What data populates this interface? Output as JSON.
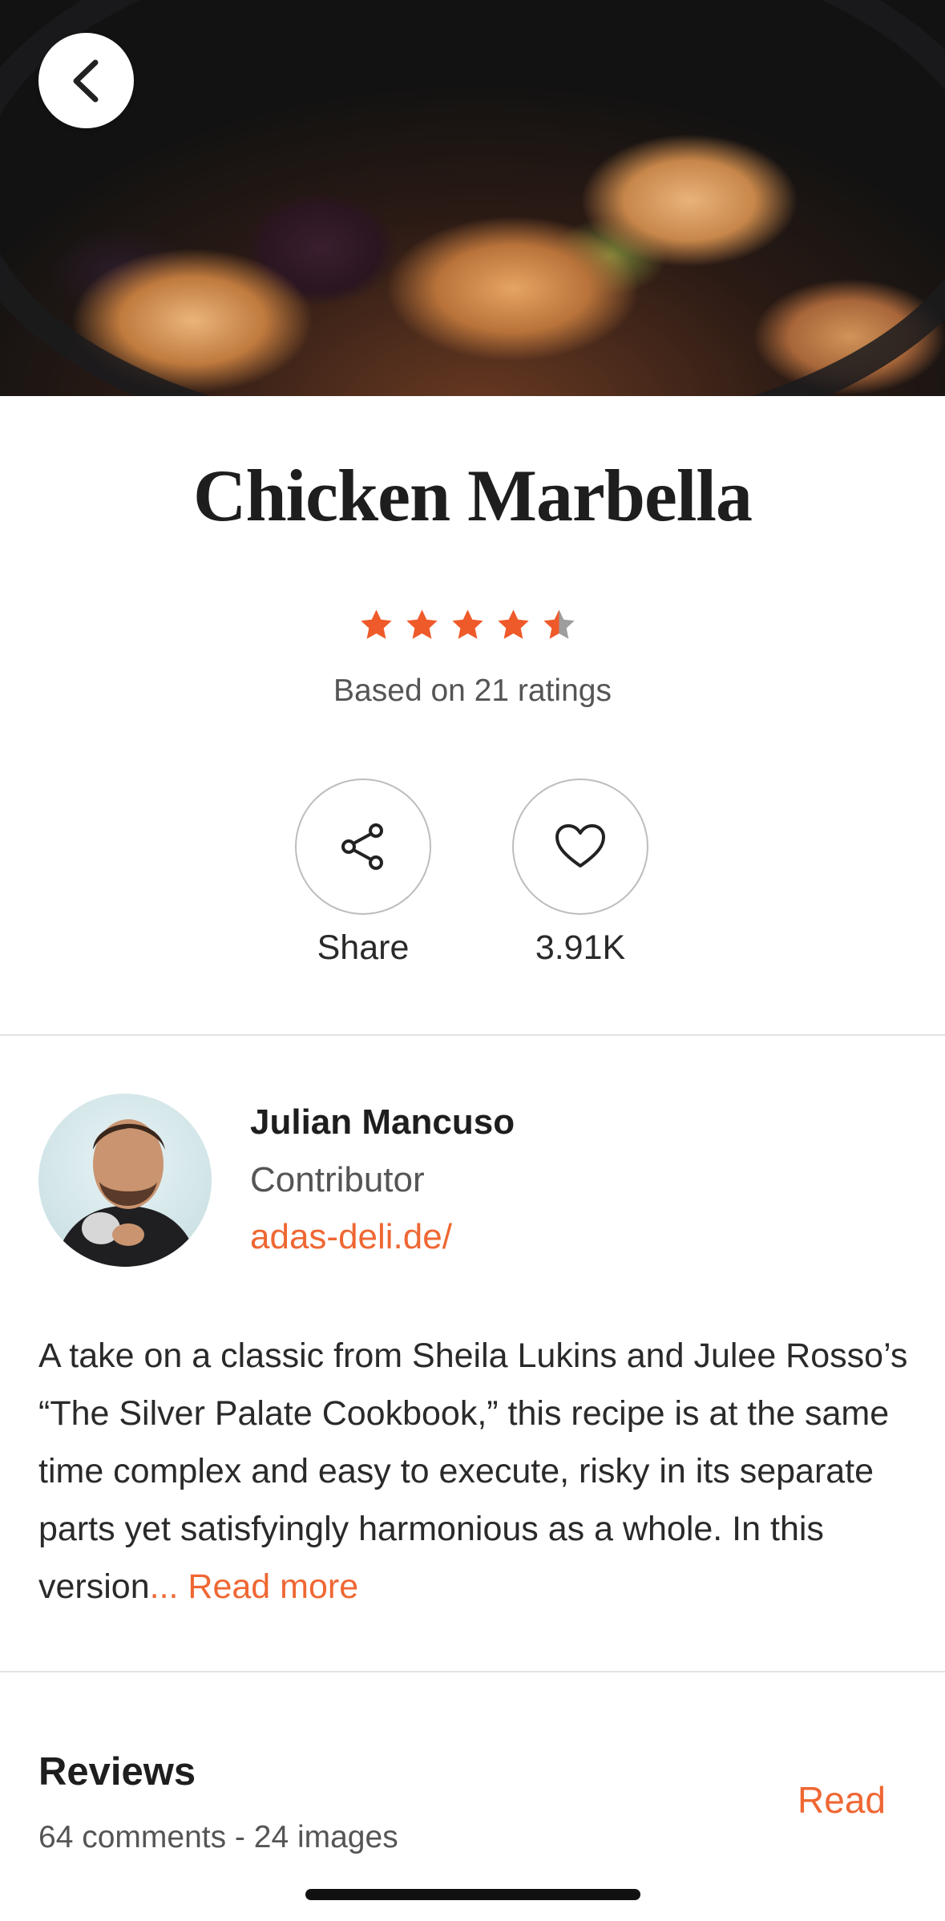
{
  "recipe": {
    "title": "Chicken Marbella",
    "rating": 4.5,
    "rating_max": 5,
    "ratings_text": "Based on 21 ratings"
  },
  "actions": {
    "share_label": "Share",
    "likes_label": "3.91K"
  },
  "author": {
    "name": "Julian Mancuso",
    "role": "Contributor",
    "link": "adas-deli.de/"
  },
  "description": {
    "text": "A take on a classic from Sheila Lukins and Julee Rosso’s “The Silver Palate Cookbook,” this recipe is at the same time complex and easy to execute, risky in its separate parts yet satisfyingly harmonious as a whole. In this version",
    "ellipsis": "...",
    "read_more": "Read more"
  },
  "reviews": {
    "title": "Reviews",
    "subtitle": "64 comments - 24 images",
    "read_label": "Read"
  },
  "icons": {
    "back": "chevron-left-icon",
    "share": "share-icon",
    "like": "heart-icon",
    "star": "star-icon"
  },
  "colors": {
    "accent": "#ef6733",
    "star_filled": "#ef5a2a",
    "star_empty": "#9e9e9e"
  }
}
